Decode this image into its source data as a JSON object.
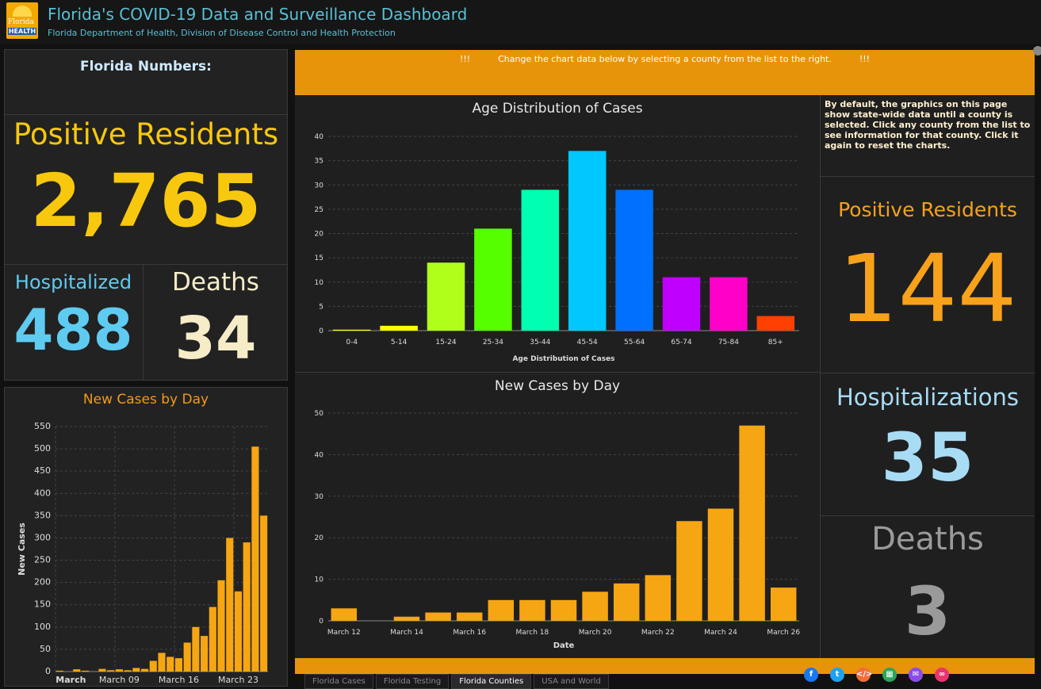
{
  "header": {
    "title": "Florida's COVID-19 Data and Surveillance Dashboard",
    "subtitle": "Florida Department of Health, Division of Disease Control and Health Protection",
    "logo_text_top": "Florida",
    "logo_text_bottom": "HEALTH"
  },
  "left": {
    "heading": "Florida Numbers:",
    "positive_label": "Positive Residents",
    "positive_value": "2,765",
    "hospitalized_label": "Hospitalized",
    "hospitalized_value": "488",
    "deaths_label": "Deaths",
    "deaths_value": "34",
    "chart_title": "New Cases by Day"
  },
  "banner": {
    "text": "!!!          Change the chart data below by selecting a county from the list to the right.          !!!"
  },
  "right": {
    "info": "By default, the graphics on this page show state-wide data until a county is selected. Click any county from the list to see information for that county. Click it again to reset the charts.",
    "positive_label": "Positive Residents",
    "positive_value": "144",
    "hosp_label": "Hospitalizations",
    "hosp_value": "35",
    "deaths_label": "Deaths",
    "deaths_value": "3"
  },
  "tabs": [
    "Florida Cases",
    "Florida Testing",
    "Florida Counties",
    "USA and World"
  ],
  "active_tab": 2,
  "social": [
    "facebook-icon",
    "twitter-icon",
    "embed-icon",
    "qr-icon",
    "email-icon",
    "link-icon"
  ],
  "social_colors": [
    "#1877f2",
    "#1da1f2",
    "#f26d3d",
    "#2aa65a",
    "#8a4de8",
    "#e8356b"
  ],
  "chart_data": [
    {
      "id": "state-new-cases",
      "type": "bar",
      "title": "New Cases by Day",
      "ylabel": "New Cases",
      "xlabel": "",
      "ylim": [
        0,
        550
      ],
      "yticks": [
        0,
        50,
        100,
        150,
        200,
        250,
        300,
        350,
        400,
        450,
        500,
        550
      ],
      "xtick_labels": [
        "March",
        "March 09",
        "March 16",
        "March 23"
      ],
      "values": [
        2,
        0,
        5,
        2,
        0,
        6,
        3,
        5,
        3,
        8,
        6,
        24,
        42,
        33,
        30,
        65,
        100,
        80,
        145,
        205,
        300,
        180,
        290,
        505,
        350
      ],
      "color": "#f6a612",
      "grid": true
    },
    {
      "id": "age-distribution",
      "type": "bar",
      "title": "Age Distribution of Cases",
      "xlabel": "Age Distribution of Cases",
      "ylim": [
        0,
        40
      ],
      "yticks": [
        0,
        5,
        10,
        15,
        20,
        25,
        30,
        35,
        40
      ],
      "categories": [
        "0-4",
        "5-14",
        "15-24",
        "25-34",
        "35-44",
        "45-54",
        "55-64",
        "65-74",
        "75-84",
        "85+"
      ],
      "values": [
        0.2,
        1,
        14,
        21,
        29,
        37,
        29,
        11,
        11,
        3
      ],
      "colors": [
        "#ffff00",
        "#ffff00",
        "#b0ff1a",
        "#55ff00",
        "#00ffb0",
        "#00c8ff",
        "#0070ff",
        "#c000ff",
        "#ff00c8",
        "#ff4000"
      ],
      "grid": true
    },
    {
      "id": "county-new-cases",
      "type": "bar",
      "title": "New Cases by Day",
      "xlabel": "Date",
      "ylim": [
        0,
        50
      ],
      "yticks": [
        0,
        10,
        20,
        30,
        40,
        50
      ],
      "categories": [
        "March 12",
        "March 13",
        "March 14",
        "March 15",
        "March 16",
        "March 17",
        "March 18",
        "March 19",
        "March 20",
        "March 21",
        "March 22",
        "March 23",
        "March 24",
        "March 25",
        "March 26"
      ],
      "xtick_labels": [
        "March 12",
        "March 14",
        "March 16",
        "March 18",
        "March 20",
        "March 22",
        "March 24",
        "March 26"
      ],
      "values": [
        3,
        0,
        1,
        2,
        2,
        5,
        5,
        5,
        7,
        9,
        11,
        24,
        27,
        47,
        8
      ],
      "color": "#f6a612",
      "grid": true
    }
  ]
}
